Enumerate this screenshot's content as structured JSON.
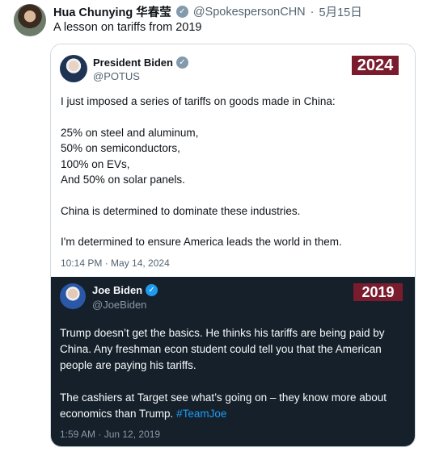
{
  "outer_post": {
    "name": "Hua Chunying 华春莹",
    "handle": "@SpokespersonCHN",
    "separator": "·",
    "date": "5月15日",
    "text": "A lesson on tariffs from 2019"
  },
  "tweet_2024": {
    "year_badge": "2024",
    "name": "President Biden",
    "handle": "@POTUS",
    "paragraphs": [
      "I just imposed a series of tariffs on goods made in China:",
      "25% on steel and aluminum,\n50% on semiconductors,\n100% on EVs,\nAnd 50% on solar panels.",
      "China is determined to dominate these industries.",
      "I'm determined to ensure America leads the world in them."
    ],
    "timestamp": "10:14 PM · May 14, 2024"
  },
  "tweet_2019": {
    "year_badge": "2019",
    "name": "Joe Biden",
    "handle": "@JoeBiden",
    "paragraph_1": "Trump doesn’t get the basics. He thinks his tariffs are being paid by China. Any freshman econ student could tell you that the American people are paying his tariffs.",
    "paragraph_2_text": "The cashiers at Target see what’s going on – they know more about economics than Trump. ",
    "hashtag": "#TeamJoe",
    "timestamp": "1:59 AM · Jun 12, 2019"
  },
  "icons": {
    "verified": "verified-checkmark-icon",
    "verified_char": "✓"
  },
  "colors": {
    "year_badge_bg": "#7a1c2e",
    "dark_tweet_bg": "#15202b",
    "link": "#1d9bf0",
    "verified_blue": "#1d9bf0",
    "verified_gray": "#829aab"
  }
}
